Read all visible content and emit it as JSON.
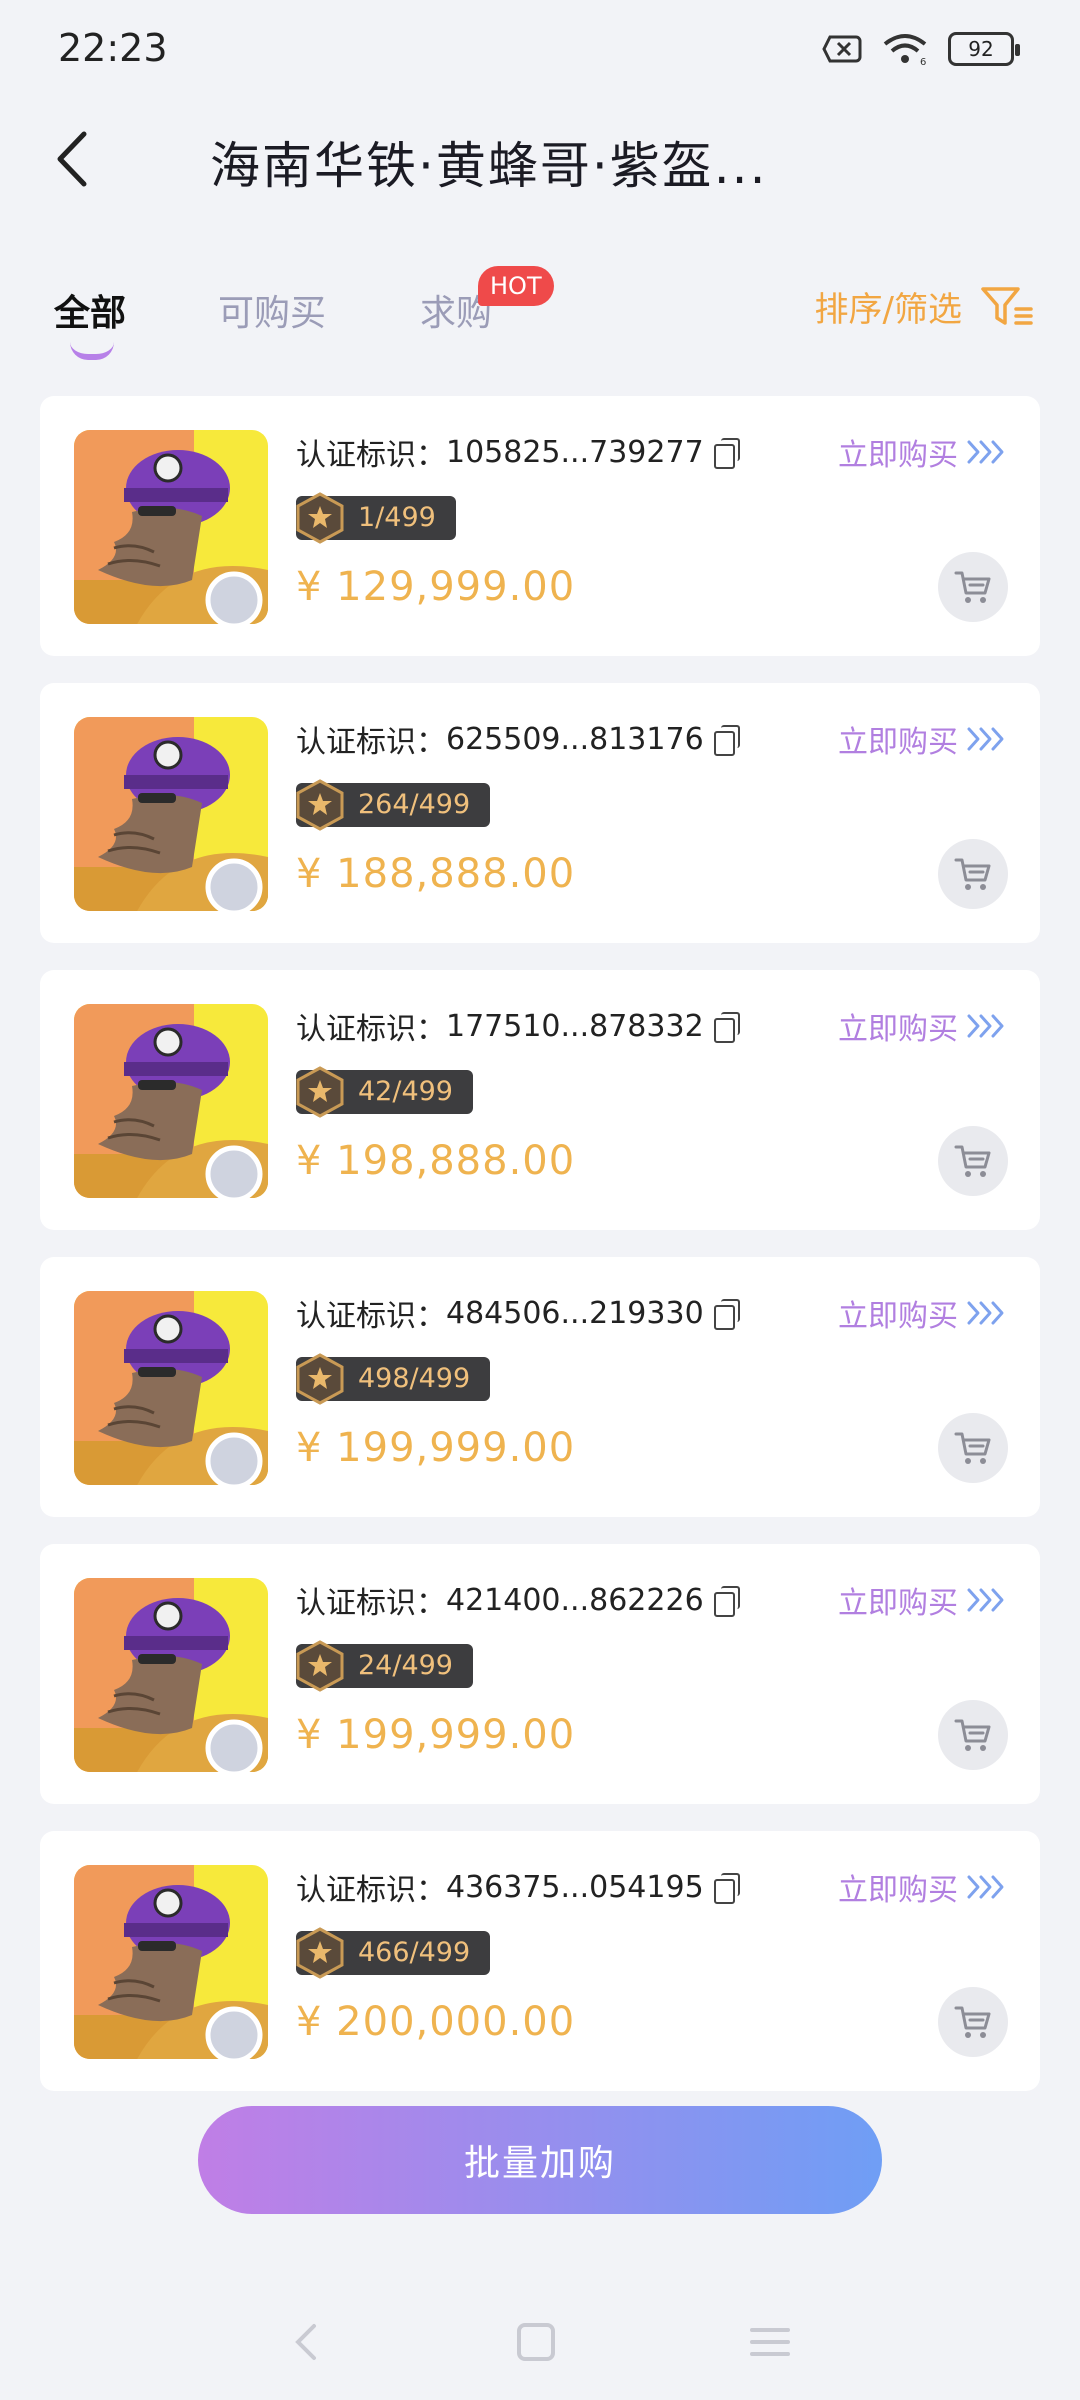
{
  "status_bar": {
    "time": "22:23",
    "battery": "92"
  },
  "header": {
    "title": "海南华铁·黄蜂哥·紫盔..."
  },
  "tabs": {
    "all": "全部",
    "buyable": "可购买",
    "want": "求购",
    "hot_badge": "HOT",
    "sort_filter": "排序/筛选"
  },
  "items": [
    {
      "cert_label": "认证标识：",
      "cert_id": "105825...739277",
      "edition": "1/499",
      "price": "¥ 129,999.00",
      "buy_label": "立即购买"
    },
    {
      "cert_label": "认证标识：",
      "cert_id": "625509...813176",
      "edition": "264/499",
      "price": "¥ 188,888.00",
      "buy_label": "立即购买"
    },
    {
      "cert_label": "认证标识：",
      "cert_id": "177510...878332",
      "edition": "42/499",
      "price": "¥ 198,888.00",
      "buy_label": "立即购买"
    },
    {
      "cert_label": "认证标识：",
      "cert_id": "484506...219330",
      "edition": "498/499",
      "price": "¥ 199,999.00",
      "buy_label": "立即购买"
    },
    {
      "cert_label": "认证标识：",
      "cert_id": "421400...862226",
      "edition": "24/499",
      "price": "¥ 199,999.00",
      "buy_label": "立即购买"
    },
    {
      "cert_label": "认证标识：",
      "cert_id": "436375...054195",
      "edition": "466/499",
      "price": "¥ 200,000.00",
      "buy_label": "立即购买"
    }
  ],
  "batch_button": "批量加购",
  "colors": {
    "accent_price": "#efb34f",
    "accent_purple": "#b17fe0",
    "accent_blue": "#6f9ef5",
    "hot_red": "#ef4a4a"
  }
}
